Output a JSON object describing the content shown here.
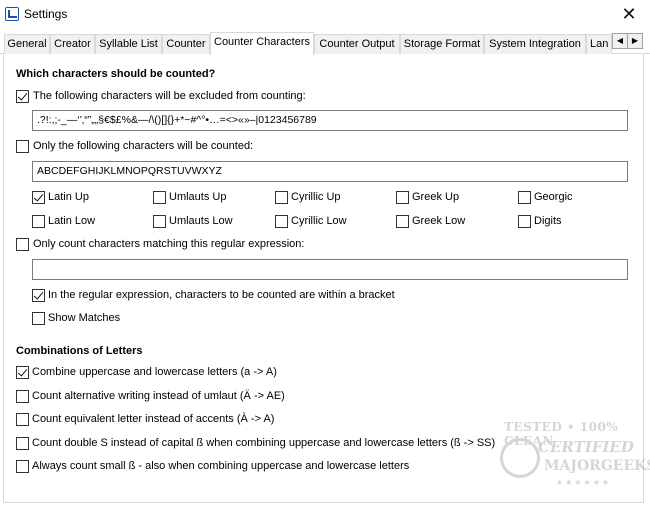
{
  "window": {
    "title": "Settings",
    "close_glyph": "✕",
    "app_icon": "app-icon"
  },
  "tabs": [
    {
      "label": "General"
    },
    {
      "label": "Creator"
    },
    {
      "label": "Syllable List"
    },
    {
      "label": "Counter"
    },
    {
      "label": "Counter Characters",
      "active": true
    },
    {
      "label": "Counter Output"
    },
    {
      "label": "Storage Format"
    },
    {
      "label": "System Integration"
    },
    {
      "label": "Lan"
    }
  ],
  "tab_scroll": {
    "left": "◀",
    "right": "▶"
  },
  "section1": {
    "heading": "Which characters should be counted?",
    "exclude": {
      "label": "The following characters will be excluded from counting:",
      "checked": true,
      "value": ".?!:,;-_—‘’‚“”„„§€$£%&—/\\()[]{}+*~#^°•…=<>«»–|0123456789"
    },
    "only": {
      "label": "Only the following characters will be counted:",
      "checked": false,
      "value": "ABCDEFGHIJKLMNOPQRSTUVWXYZ"
    },
    "char_sets": [
      {
        "label": "Latin Up",
        "checked": true
      },
      {
        "label": "Umlauts Up",
        "checked": false
      },
      {
        "label": "Cyrillic Up",
        "checked": false
      },
      {
        "label": "Greek Up",
        "checked": false
      },
      {
        "label": "Georgic",
        "checked": false
      },
      {
        "label": "Latin Low",
        "checked": false
      },
      {
        "label": "Umlauts Low",
        "checked": false
      },
      {
        "label": "Cyrillic Low",
        "checked": false
      },
      {
        "label": "Greek Low",
        "checked": false
      },
      {
        "label": "Digits",
        "checked": false
      }
    ],
    "regex": {
      "label": "Only count characters matching this regular expression:",
      "checked": false,
      "value": ""
    },
    "bracket": {
      "label": "In the regular expression, characters to be counted are within a bracket",
      "checked": true
    },
    "show_matches": {
      "label": "Show Matches",
      "checked": false
    }
  },
  "section2": {
    "heading": "Combinations of Letters",
    "options": [
      {
        "label": "Combine uppercase and lowercase letters (a -> A)",
        "checked": true
      },
      {
        "label": "Count alternative writing instead of umlaut (Ä -> AE)",
        "checked": false
      },
      {
        "label": "Count equivalent letter instead of accents (À -> A)",
        "checked": false
      },
      {
        "label": "Count double S instead of capital ß when combining uppercase and lowercase letters (ß -> SS)",
        "checked": false
      },
      {
        "label": "Always count small ß - also when combining uppercase and lowercase letters",
        "checked": false
      }
    ]
  },
  "watermark": {
    "line1": "TESTED • 100% CLEAN",
    "line2": "CERTIFIED",
    "line3": "MAJORGEEKS",
    "line4": "★★★★★★"
  }
}
